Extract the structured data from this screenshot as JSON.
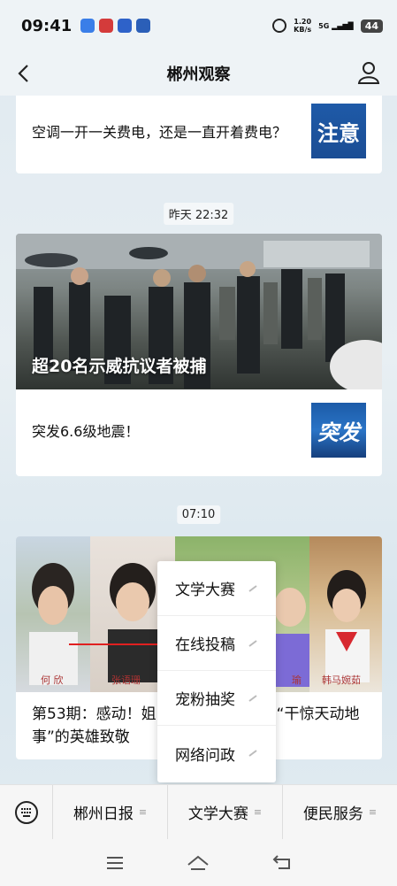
{
  "status_bar": {
    "time": "09:41",
    "speed": "1.20\nKB/s",
    "network": "5G",
    "battery": "44"
  },
  "header": {
    "title": "郴州观察"
  },
  "card1": {
    "text": "空调一开一关费电，还是一直开着费电？",
    "thumb_label": "注意"
  },
  "time1": "昨天 22:32",
  "card2": {
    "hero_caption": "超20名示威抗议者被捕",
    "text": "突发6.6级地震！",
    "thumb_label": "突发"
  },
  "time2": "07:10",
  "card3": {
    "name_tags": [
      "何 欣",
      "张语珊",
      "瑜",
      "韩马婉茹"
    ],
    "title": "第53期：感动！姐　　　　　　　　“干惊天动地事”的英雄致敬"
  },
  "popup_menu": {
    "items": [
      "文学大赛",
      "在线投稿",
      "宠粉抽奖",
      "网络问政"
    ]
  },
  "bottom_menu": {
    "tabs": [
      "郴州日报",
      "文学大赛",
      "便民服务"
    ]
  },
  "colors": {
    "accent_red": "#e02020",
    "thumb_blue": "#1e5aa8"
  }
}
